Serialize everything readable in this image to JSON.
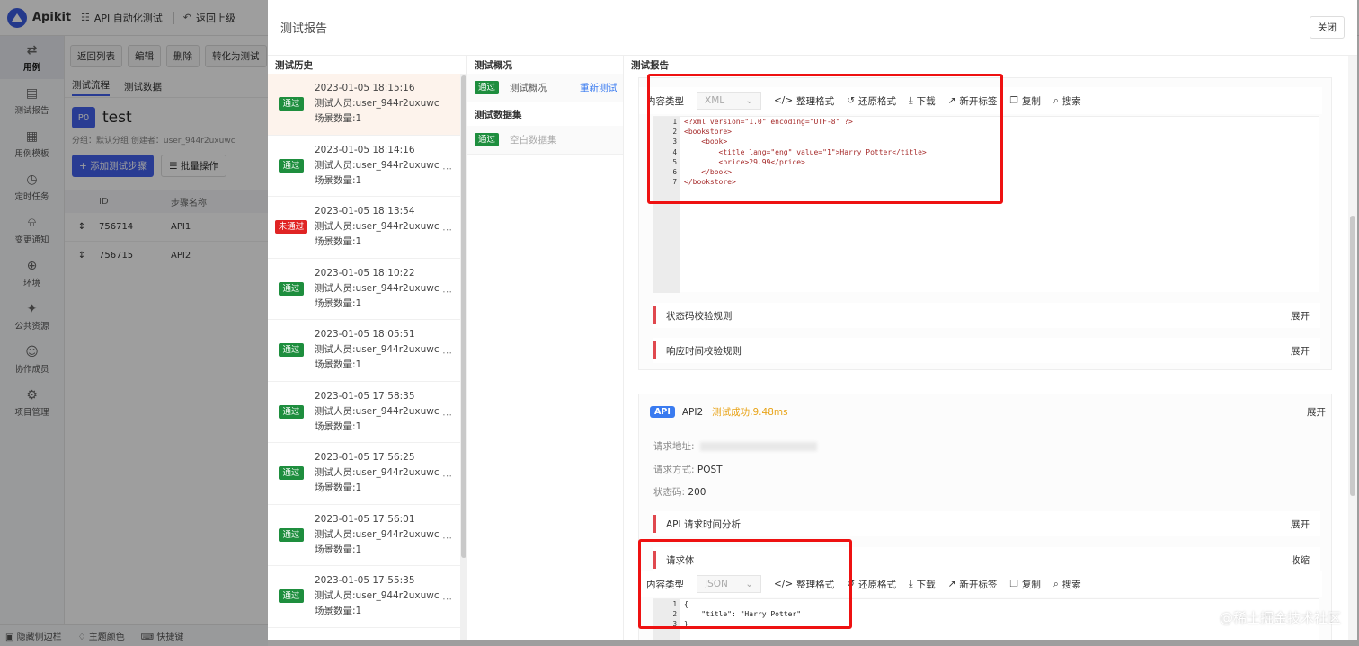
{
  "app": {
    "logo": "Apikit",
    "topbar": [
      {
        "icon": "grid-icon",
        "label": "API 自动化测试"
      },
      {
        "icon": "back-icon",
        "label": "返回上级"
      }
    ]
  },
  "sidebar": {
    "items": [
      {
        "label": "用例",
        "icon": "swap-icon",
        "active": true
      },
      {
        "label": "测试报告",
        "icon": "report-icon"
      },
      {
        "label": "用例模板",
        "icon": "template-icon"
      },
      {
        "label": "定时任务",
        "icon": "clock-icon"
      },
      {
        "label": "变更通知",
        "icon": "bell-icon"
      },
      {
        "label": "环境",
        "icon": "globe-icon"
      },
      {
        "label": "公共资源",
        "icon": "puzzle-icon"
      },
      {
        "label": "协作成员",
        "icon": "users-icon"
      },
      {
        "label": "项目管理",
        "icon": "gear-icon"
      }
    ],
    "bottom": [
      "隐藏侧边栏",
      "主题颜色",
      "快捷键"
    ]
  },
  "page": {
    "buttons": [
      "返回列表",
      "编辑",
      "删除",
      "转化为测试"
    ],
    "tabs": [
      "测试流程",
      "测试数据"
    ],
    "badge": "P0",
    "title": "test",
    "meta": "分组：默认分组     创建者：user_944r2uxuwc",
    "add_step": "添加测试步骤",
    "batch": "批量操作",
    "table": {
      "headers": [
        "ID",
        "步骤名称"
      ],
      "rows": [
        [
          "756714",
          "API1"
        ],
        [
          "756715",
          "API2"
        ]
      ]
    }
  },
  "modal": {
    "title": "测试报告",
    "close": "关闭",
    "history_header": "测试历史",
    "summary_header": "测试概况",
    "report_header": "测试报告",
    "history": [
      {
        "status": "pass",
        "badge": "通过",
        "time": "2023-01-05 18:15:16",
        "tester": "测试人员:user_944r2uxuwc",
        "count": "场景数量:1",
        "selected": true
      },
      {
        "status": "pass",
        "badge": "通过",
        "time": "2023-01-05 18:14:16",
        "tester": "测试人员:user_944r2uxuwc",
        "count": "场景数量:1"
      },
      {
        "status": "fail",
        "badge": "未通过",
        "time": "2023-01-05 18:13:54",
        "tester": "测试人员:user_944r2uxuwc",
        "count": "场景数量:1"
      },
      {
        "status": "pass",
        "badge": "通过",
        "time": "2023-01-05 18:10:22",
        "tester": "测试人员:user_944r2uxuwc",
        "count": "场景数量:1"
      },
      {
        "status": "pass",
        "badge": "通过",
        "time": "2023-01-05 18:05:51",
        "tester": "测试人员:user_944r2uxuwc",
        "count": "场景数量:1"
      },
      {
        "status": "pass",
        "badge": "通过",
        "time": "2023-01-05 17:58:35",
        "tester": "测试人员:user_944r2uxuwc",
        "count": "场景数量:1"
      },
      {
        "status": "pass",
        "badge": "通过",
        "time": "2023-01-05 17:56:25",
        "tester": "测试人员:user_944r2uxuwc",
        "count": "场景数量:1"
      },
      {
        "status": "pass",
        "badge": "通过",
        "time": "2023-01-05 17:56:01",
        "tester": "测试人员:user_944r2uxuwc",
        "count": "场景数量:1"
      },
      {
        "status": "pass",
        "badge": "通过",
        "time": "2023-01-05 17:55:35",
        "tester": "测试人员:user_944r2uxuwc",
        "count": "场景数量:1"
      }
    ],
    "summary": {
      "pass_badge": "通过",
      "overview": "测试概况",
      "rerun": "重新测试",
      "dataset_header": "测试数据集",
      "dataset": "空白数据集"
    },
    "toolbar": {
      "content_type_label": "内容类型",
      "format": "整理格式",
      "restore": "还原格式",
      "download": "下载",
      "new_tab": "新开标签",
      "copy": "复制",
      "search": "搜索"
    },
    "response": {
      "content_type": "XML",
      "lines": [
        "<?xml version=\"1.0\" encoding=\"UTF-8\" ?>",
        "<bookstore>",
        "    <book>",
        "        <title lang=\"eng\" value=\"1\">Harry Potter</title>",
        "        <price>29.99</price>",
        "    </book>",
        "</bookstore>"
      ],
      "line_numbers": [
        "1",
        "2",
        "3",
        "4",
        "5",
        "6",
        "7"
      ]
    },
    "rules": [
      {
        "name": "状态码校验规则",
        "action": "展开"
      },
      {
        "name": "响应时间校验规则",
        "action": "展开"
      }
    ],
    "api2": {
      "tag": "API",
      "name": "API2",
      "result": "测试成功,9.48ms",
      "expand": "展开",
      "url_label": "请求地址:",
      "method_label": "请求方式:",
      "method": "POST",
      "status_label": "状态码:",
      "status": "200",
      "timing": "API 请求时间分析",
      "timing_action": "展开",
      "body": "请求体",
      "body_action": "收缩",
      "body_type": "JSON",
      "body_lines": [
        "{",
        "    \"title\": \"Harry Potter\"",
        "}"
      ],
      "body_numbers": [
        "1",
        "2",
        "3"
      ]
    },
    "watermark": "@稀土掘金技术社区"
  },
  "colors": {
    "accent": "#4361ee",
    "pass": "#1e8e3e",
    "fail": "#e02424",
    "highlight": "#e11111",
    "link": "#3a7bf0",
    "success_text": "#e8a317"
  }
}
